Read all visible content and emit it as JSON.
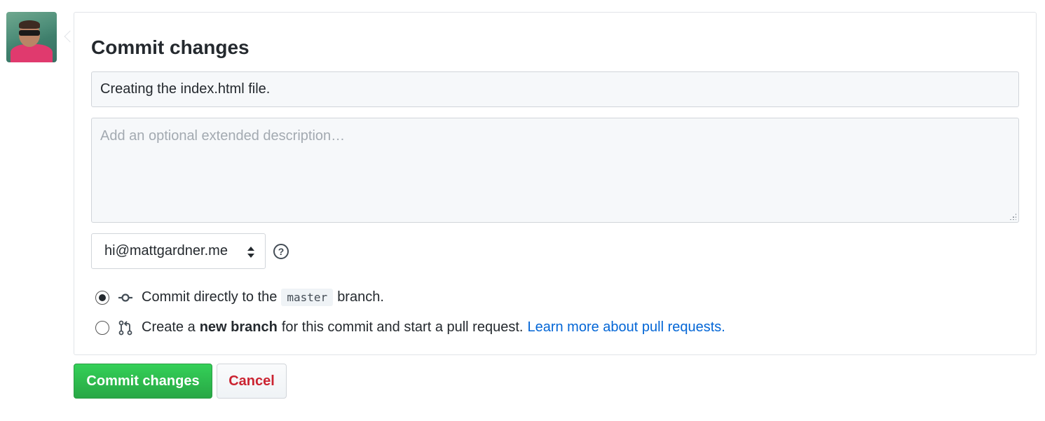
{
  "user": {
    "avatar_alt": "user avatar"
  },
  "commit_form": {
    "title": "Commit changes",
    "summary_value": "Creating the index.html file.",
    "description_placeholder": "Add an optional extended description…",
    "email_selected": "hi@mattgardner.me",
    "help_glyph": "?",
    "options": [
      {
        "checked": true,
        "icon": "git-commit-icon",
        "text_before": "Commit directly to the",
        "branch": "master",
        "text_after": "branch."
      },
      {
        "checked": false,
        "icon": "git-pull-request-icon",
        "text_before": "Create a",
        "bold": "new branch",
        "text_after": "for this commit and start a pull request.",
        "link": "Learn more about pull requests."
      }
    ]
  },
  "buttons": {
    "commit": "Commit changes",
    "cancel": "Cancel"
  },
  "colors": {
    "primary_green": "#28a745",
    "link_blue": "#0366d6",
    "cancel_red": "#cb2431"
  }
}
